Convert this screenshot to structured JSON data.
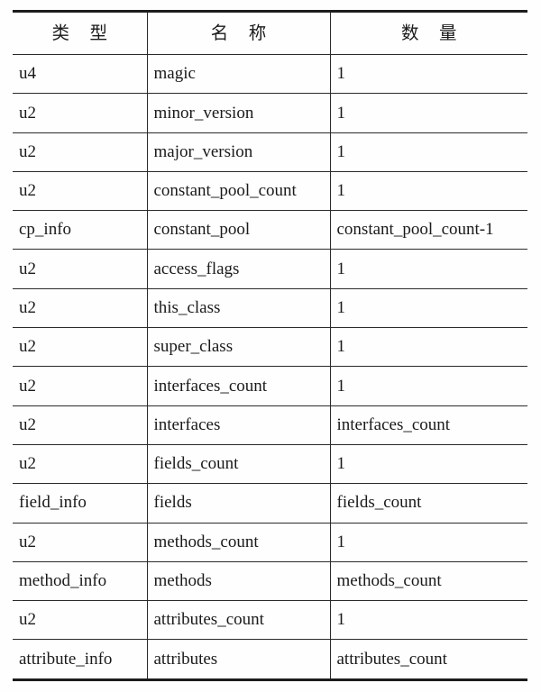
{
  "table": {
    "headers": {
      "type": "类 型",
      "name": "名 称",
      "count": "数 量"
    },
    "rows": [
      {
        "type": "u4",
        "name": "magic",
        "count": "1"
      },
      {
        "type": "u2",
        "name": "minor_version",
        "count": "1"
      },
      {
        "type": "u2",
        "name": "major_version",
        "count": "1"
      },
      {
        "type": "u2",
        "name": "constant_pool_count",
        "count": "1"
      },
      {
        "type": "cp_info",
        "name": "constant_pool",
        "count": "constant_pool_count-1"
      },
      {
        "type": "u2",
        "name": "access_flags",
        "count": "1"
      },
      {
        "type": "u2",
        "name": "this_class",
        "count": "1"
      },
      {
        "type": "u2",
        "name": "super_class",
        "count": "1"
      },
      {
        "type": "u2",
        "name": "interfaces_count",
        "count": "1"
      },
      {
        "type": "u2",
        "name": "interfaces",
        "count": "interfaces_count"
      },
      {
        "type": "u2",
        "name": "fields_count",
        "count": "1"
      },
      {
        "type": "field_info",
        "name": "fields",
        "count": "fields_count"
      },
      {
        "type": "u2",
        "name": "methods_count",
        "count": "1"
      },
      {
        "type": "method_info",
        "name": "methods",
        "count": "methods_count"
      },
      {
        "type": "u2",
        "name": "attributes_count",
        "count": "1"
      },
      {
        "type": "attribute_info",
        "name": "attributes",
        "count": "attributes_count"
      }
    ]
  },
  "style": {
    "rule_color": "#2a2a2a",
    "heavy_rule_color": "#1c1c1c",
    "text_color": "#1a1a1a",
    "background": "#fefefe"
  }
}
